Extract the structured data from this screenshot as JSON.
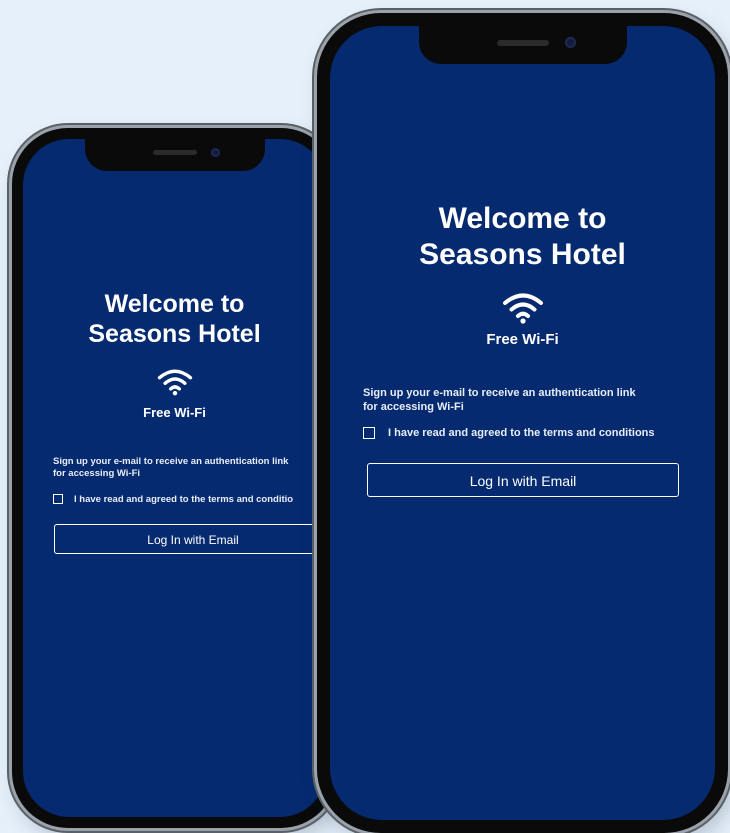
{
  "screens": [
    {
      "title_line1": "Welcome to",
      "title_line2": "Seasons Hotel",
      "subtitle": "Free Wi-Fi",
      "description_line1": "Sign up your e-mail to receive an authentication link",
      "description_line2": "for accessing Wi-Fi",
      "terms_label": "I have read and agreed to the terms and conditio",
      "login_label": "Log In with Email"
    },
    {
      "title_line1": "Welcome to",
      "title_line2": "Seasons Hotel",
      "subtitle": "Free Wi-Fi",
      "description_line1": "Sign up your e-mail to receive an authentication link",
      "description_line2": "for accessing Wi-Fi",
      "terms_label": "I have read and agreed to the terms and conditions",
      "login_label": "Log In with Email"
    }
  ],
  "colors": {
    "page_background": "#e6f0fa",
    "screen_background": "#062a70",
    "phone_frame": "#0a0a0a",
    "text": "#ffffff"
  },
  "icons": {
    "wifi": "wifi-icon",
    "checkbox": "checkbox-unchecked"
  }
}
